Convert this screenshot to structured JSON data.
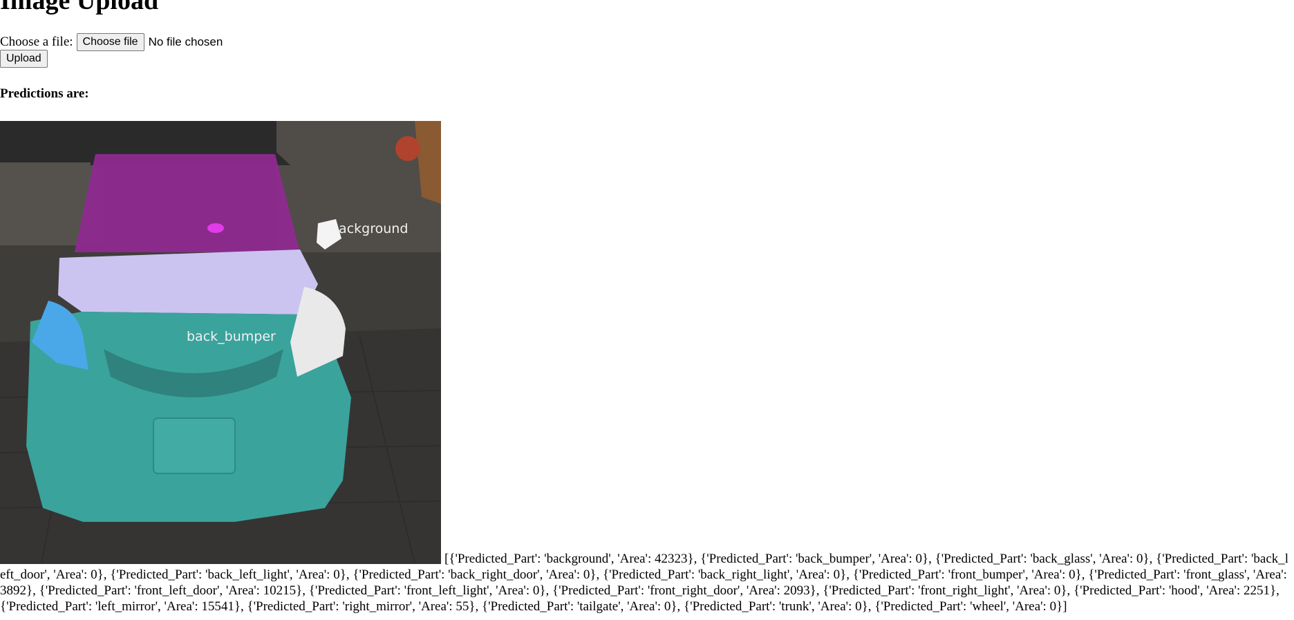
{
  "page": {
    "title": "Image Upload",
    "file_input_label": "Choose a file:",
    "choose_button": "Choose file",
    "file_status": "No file chosen",
    "upload_button": "Upload",
    "predictions_label": "Predictions are:"
  },
  "image": {
    "overlay_labels": [
      "background",
      "back_bumper"
    ]
  },
  "predictions_text": "[{'Predicted_Part': 'background', 'Area': 42323}, {'Predicted_Part': 'back_bumper', 'Area': 0}, {'Predicted_Part': 'back_glass', 'Area': 0}, {'Predicted_Part': 'back_left_door', 'Area': 0}, {'Predicted_Part': 'back_left_light', 'Area': 0}, {'Predicted_Part': 'back_right_door', 'Area': 0}, {'Predicted_Part': 'back_right_light', 'Area': 0}, {'Predicted_Part': 'front_bumper', 'Area': 0}, {'Predicted_Part': 'front_glass', 'Area': 3892}, {'Predicted_Part': 'front_left_door', 'Area': 10215}, {'Predicted_Part': 'front_left_light', 'Area': 0}, {'Predicted_Part': 'front_right_door', 'Area': 2093}, {'Predicted_Part': 'front_right_light', 'Area': 0}, {'Predicted_Part': 'hood', 'Area': 2251}, {'Predicted_Part': 'left_mirror', 'Area': 15541}, {'Predicted_Part': 'right_mirror', 'Area': 55}, {'Predicted_Part': 'tailgate', 'Area': 0}, {'Predicted_Part': 'trunk', 'Area': 0}, {'Predicted_Part': 'wheel', 'Area': 0}]"
}
